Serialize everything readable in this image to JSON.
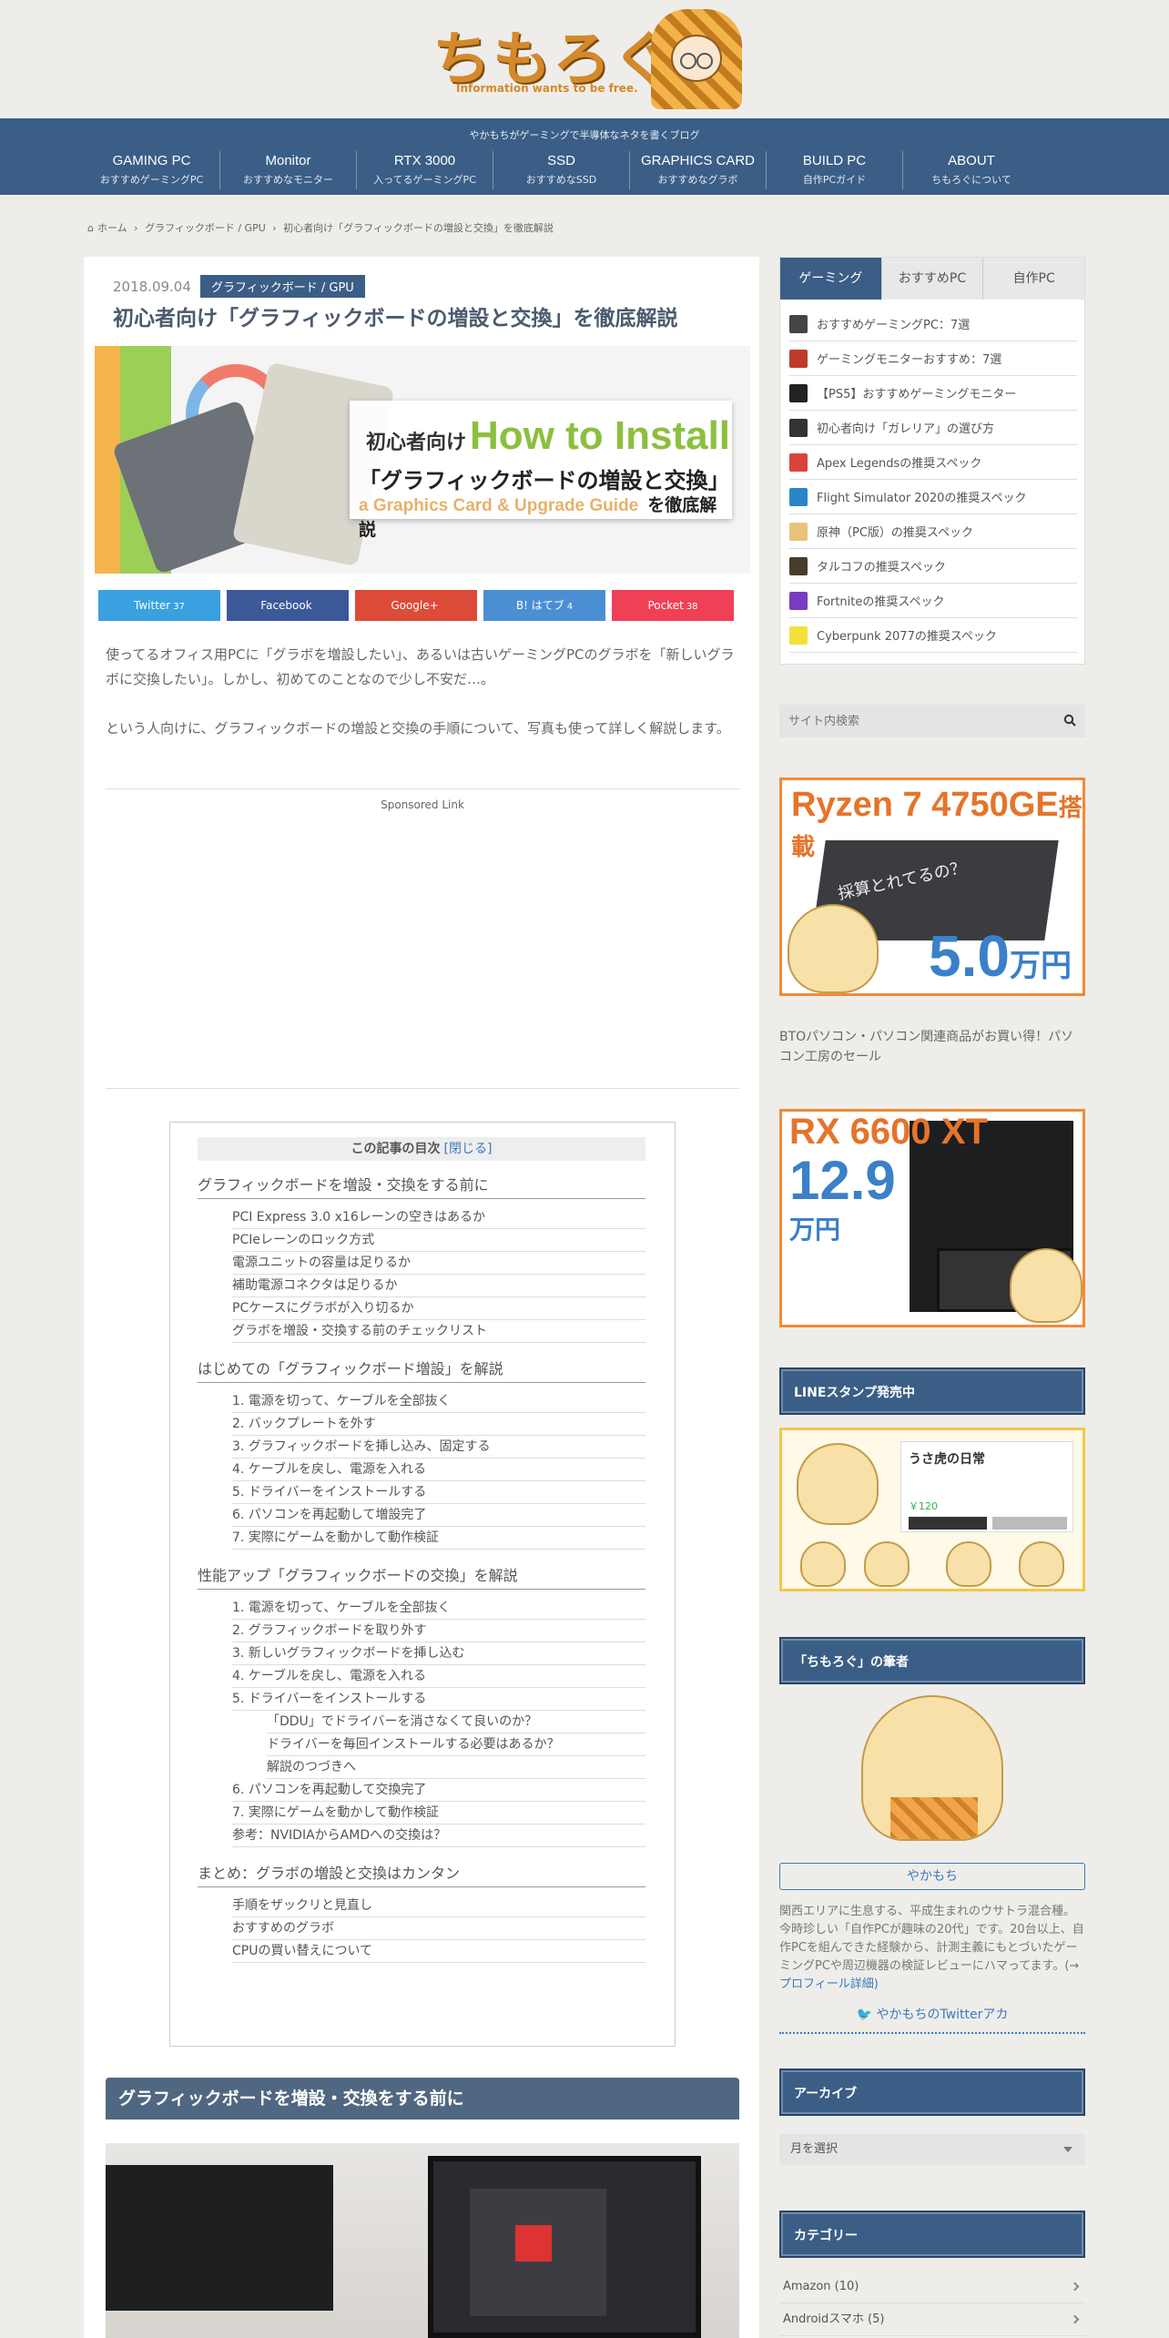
{
  "header": {
    "logo_text": "ちもろぐ",
    "logo_tagline": "Information wants to be free.",
    "description": "やかもちがゲーミングで半導体なネタを書くブログ"
  },
  "nav": [
    {
      "en": "GAMING PC",
      "ja": "おすすめゲーミングPC"
    },
    {
      "en": "Monitor",
      "ja": "おすすめなモニター"
    },
    {
      "en": "RTX 3000",
      "ja": "入ってるゲーミングPC"
    },
    {
      "en": "SSD",
      "ja": "おすすめなSSD"
    },
    {
      "en": "GRAPHICS CARD",
      "ja": "おすすめなグラボ"
    },
    {
      "en": "BUILD PC",
      "ja": "自作PCガイド"
    },
    {
      "en": "ABOUT",
      "ja": "ちもろぐについて"
    }
  ],
  "breadcrumb": {
    "home": "ホーム",
    "category": "グラフィックボード / GPU",
    "current": "初心者向け「グラフィックボードの増設と交換」を徹底解説"
  },
  "article": {
    "date": "2018.09.04",
    "category": "グラフィックボード / GPU",
    "title": "初心者向け「グラフィックボードの増設と交換」を徹底解説",
    "eyecatch": {
      "line1_ja": "初心者向け",
      "line1_en": "How to Install",
      "line2": "「グラフィックボードの増設と交換」",
      "line3_en": "a Graphics Card & Upgrade Guide",
      "line3_ja": "を徹底解説"
    },
    "share": [
      {
        "label": "Twitter",
        "count": "37",
        "color": "#3aa0e0"
      },
      {
        "label": "Facebook",
        "count": "",
        "color": "#3b5998"
      },
      {
        "label": "Google+",
        "count": "",
        "color": "#dd4b39"
      },
      {
        "label": "B! はてブ",
        "count": "4",
        "color": "#4a8fd3"
      },
      {
        "label": "Pocket",
        "count": "38",
        "color": "#ef4056"
      }
    ],
    "intro": [
      "使ってるオフィス用PCに「グラボを増設したい」、あるいは古いゲーミングPCのグラボを「新しいグラボに交換したい」。しかし、初めてのことなので少し不安だ…。",
      "という人向けに、グラフィックボードの増設と交換の手順について、写真も使って詳しく解説します。"
    ],
    "sponsored": "Sponsored Link",
    "section_heading": "グラフィックボードを増設・交換をする前に"
  },
  "toc": {
    "title": "この記事の目次",
    "close": "[閉じる]",
    "sections": [
      {
        "h2": "グラフィックボードを増設・交換をする前に",
        "items": [
          {
            "t": "PCI Express 3.0 x16レーンの空きはあるか",
            "lv": 3
          },
          {
            "t": "PCIeレーンのロック方式",
            "lv": 3
          },
          {
            "t": "電源ユニットの容量は足りるか",
            "lv": 3
          },
          {
            "t": "補助電源コネクタは足りるか",
            "lv": 3
          },
          {
            "t": "PCケースにグラボが入り切るか",
            "lv": 3
          },
          {
            "t": "グラボを増設・交換する前のチェックリスト",
            "lv": 3
          }
        ]
      },
      {
        "h2": "はじめての「グラフィックボード増設」を解説",
        "items": [
          {
            "t": "1. 電源を切って、ケーブルを全部抜く",
            "lv": 3
          },
          {
            "t": "2. バックプレートを外す",
            "lv": 3
          },
          {
            "t": "3. グラフィックボードを挿し込み、固定する",
            "lv": 3
          },
          {
            "t": "4. ケーブルを戻し、電源を入れる",
            "lv": 3
          },
          {
            "t": "5. ドライバーをインストールする",
            "lv": 3
          },
          {
            "t": "6. パソコンを再起動して増設完了",
            "lv": 3
          },
          {
            "t": "7. 実際にゲームを動かして動作検証",
            "lv": 3
          }
        ]
      },
      {
        "h2": "性能アップ「グラフィックボードの交換」を解説",
        "items": [
          {
            "t": "1. 電源を切って、ケーブルを全部抜く",
            "lv": 3
          },
          {
            "t": "2. グラフィックボードを取り外す",
            "lv": 3
          },
          {
            "t": "3. 新しいグラフィックボードを挿し込む",
            "lv": 3
          },
          {
            "t": "4. ケーブルを戻し、電源を入れる",
            "lv": 3
          },
          {
            "t": "5. ドライバーをインストールする",
            "lv": 3
          },
          {
            "t": "「DDU」でドライバーを消さなくて良いのか？",
            "lv": 4
          },
          {
            "t": "ドライバーを毎回インストールする必要はあるか？",
            "lv": 4
          },
          {
            "t": "解説のつづきへ",
            "lv": 4
          },
          {
            "t": "6. パソコンを再起動して交換完了",
            "lv": 3
          },
          {
            "t": "7. 実際にゲームを動かして動作検証",
            "lv": 3
          },
          {
            "t": "参考：NVIDIAからAMDへの交換は？",
            "lv": 3
          }
        ]
      },
      {
        "h2": "まとめ：グラボの増設と交換はカンタン",
        "items": [
          {
            "t": "手順をザックリと見直し",
            "lv": 3
          },
          {
            "t": "おすすめのグラボ",
            "lv": 3
          },
          {
            "t": "CPUの買い替えについて",
            "lv": 3
          }
        ]
      }
    ]
  },
  "sidebar": {
    "tabs": [
      "ゲーミング",
      "おすすめPC",
      "自作PC"
    ],
    "ranking": [
      {
        "t": "おすすめゲーミングPC：7選",
        "c": "#444"
      },
      {
        "t": "ゲーミングモニターおすすめ：7選",
        "c": "#c0392b"
      },
      {
        "t": "【PS5】おすすめゲーミングモニター",
        "c": "#222"
      },
      {
        "t": "初心者向け「ガレリア」の選び方",
        "c": "#333"
      },
      {
        "t": "Apex Legendsの推奨スペック",
        "c": "#d9433b"
      },
      {
        "t": "Flight Simulator 2020の推奨スペック",
        "c": "#2a86c8"
      },
      {
        "t": "原神（PC版）の推奨スペック",
        "c": "#e8c47a"
      },
      {
        "t": "タルコフの推奨スペック",
        "c": "#4a3c2a"
      },
      {
        "t": "Fortniteの推奨スペック",
        "c": "#7a3cc0"
      },
      {
        "t": "Cyberpunk 2077の推奨スペック",
        "c": "#f3e03b"
      }
    ],
    "search_placeholder": "サイト内検索",
    "ad1": {
      "title": "Ryzen 7 4750GE",
      "title_suffix": "搭載",
      "caption": "採算とれてるの？",
      "price": "5.0",
      "unit": "万円"
    },
    "broken_image_alt": "BTOパソコン・パソコン関連商品がお買い得！パソコン工房のセール",
    "ad2": {
      "title": "RX 6600 XT",
      "price": "12.9",
      "unit": "万円"
    },
    "line_widget": {
      "heading": "LINEスタンプ発売中",
      "sticker_title": "うさ虎の日常",
      "price": "￥120"
    },
    "author_widget": {
      "heading": "「ちもろぐ」の筆者",
      "name": "やかもち",
      "desc": "関西エリアに生息する、平成生まれのウサトラ混合種。今時珍しい「自作PCが趣味の20代」です。20台以上、自作PCを組んできた経験から、計測主義にもとづいたゲーミングPCや周辺機器の検証レビューにハマってます。(→",
      "more": "プロフィール詳細)",
      "twitter": "やかもちのTwitterアカ"
    },
    "archive_widget": {
      "heading": "アーカイブ",
      "select": "月を選択"
    },
    "category_widget": {
      "heading": "カテゴリー",
      "items": [
        "Amazon (10)",
        "Androidスマホ (5)"
      ]
    }
  }
}
